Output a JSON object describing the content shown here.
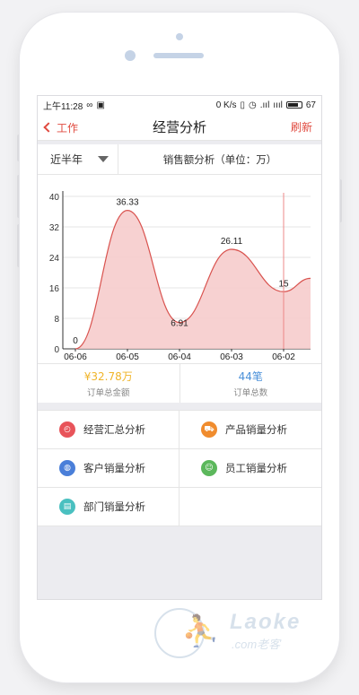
{
  "statusbar": {
    "time": "上午11:28",
    "network_speed": "0 K/s",
    "battery_level": "67"
  },
  "navbar": {
    "back_label": "工作",
    "title": "经营分析",
    "refresh_label": "刷新"
  },
  "filter": {
    "period": "近半年",
    "chart_label": "销售额分析（单位：万）"
  },
  "chart_data": {
    "type": "area",
    "categories": [
      "06-06",
      "06-05",
      "06-04",
      "06-03",
      "06-02"
    ],
    "x_ticks": [
      "06-06",
      "06-05",
      "06-04",
      "06-03",
      "06-02"
    ],
    "values": [
      0,
      36.33,
      6.91,
      26.11,
      15
    ],
    "data_labels": [
      "0",
      "36.33",
      "6.91",
      "26.11",
      "15"
    ],
    "y_ticks": [
      "0",
      "8",
      "16",
      "24",
      "32",
      "40"
    ],
    "ylim": [
      0,
      40
    ],
    "fill_color": "#f6c9c9",
    "line_color": "#d9534f",
    "grid": true
  },
  "summary": {
    "amount_value": "¥32.78万",
    "amount_label": "订单总金额",
    "count_value": "44笔",
    "count_label": "订单总数",
    "amount_color": "#f0b429",
    "count_color": "#4a90d9"
  },
  "menu": [
    {
      "label": "经营汇总分析",
      "icon": "gauge-icon",
      "color": "#e8545a"
    },
    {
      "label": "产品销量分析",
      "icon": "cart-icon",
      "color": "#f08c2e"
    },
    {
      "label": "客户销量分析",
      "icon": "globe-icon",
      "color": "#4a7fd9"
    },
    {
      "label": "员工销量分析",
      "icon": "person-icon",
      "color": "#5cb85c"
    },
    {
      "label": "部门销量分析",
      "icon": "calendar-icon",
      "color": "#4ac0c0"
    }
  ],
  "watermark": {
    "brand": "Laoke",
    "sub": ".com老客"
  }
}
